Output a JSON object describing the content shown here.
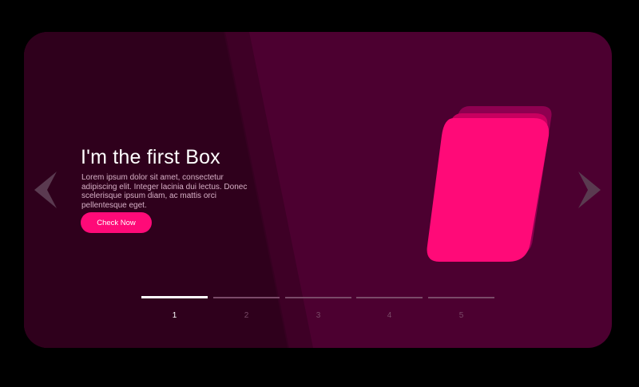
{
  "slide": {
    "title": "I'm the first Box",
    "body": "Lorem ipsum dolor sit amet, consectetur adipiscing elit. Integer lacinia dui lectus. Donec scelerisque ipsum diam, ac mattis orci pellentesque eget.",
    "cta_label": "Check Now"
  },
  "navigation": {
    "prev_icon": "chevron-left-icon",
    "next_icon": "chevron-right-icon"
  },
  "pager": {
    "items": [
      {
        "label": "1",
        "active": true
      },
      {
        "label": "2",
        "active": false
      },
      {
        "label": "3",
        "active": false
      },
      {
        "label": "4",
        "active": false
      },
      {
        "label": "5",
        "active": false
      }
    ]
  },
  "colors": {
    "page_background": "#000000",
    "card_background": "#4c0030",
    "card_shadow_band": "#33001f",
    "accent": "#ff0a78",
    "accent_dim": "#c8005f",
    "accent_dark": "#8e0050",
    "text_primary": "#ffffff",
    "text_muted": "#d6b0c6",
    "pager_inactive": "#7a4a68",
    "arrow": "#5a3a50"
  }
}
